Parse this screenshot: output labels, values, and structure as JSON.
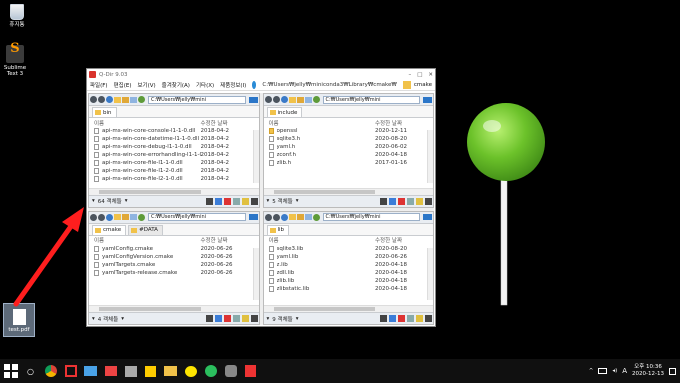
{
  "desktop": {
    "icons": [
      {
        "label": "휴지통"
      },
      {
        "label": "Sublime Text 3"
      },
      {
        "label": "test.pdf"
      }
    ]
  },
  "window": {
    "title": "Q-Dir 9.03",
    "menu": [
      "파일(F)",
      "편집(E)",
      "보기(V)",
      "즐겨찾기(A)",
      "기타(X)",
      "제품정보(I)"
    ],
    "menu_right": "cmake",
    "menu_address": "C:₩Users₩jelly₩miniconda3₩Library₩cmake₩",
    "panes": [
      {
        "address": "C:₩Users₩jelly₩mini",
        "tabs": [
          "bin"
        ],
        "header_name": "이름",
        "header_date": "수정한 날짜",
        "rows": [
          {
            "name": "api-ms-win-core-console-l1-1-0.dll",
            "date": "2018-04-2"
          },
          {
            "name": "api-ms-win-core-datetime-l1-1-0.dll",
            "date": "2018-04-2"
          },
          {
            "name": "api-ms-win-core-debug-l1-1-0.dll",
            "date": "2018-04-2"
          },
          {
            "name": "api-ms-win-core-errorhandling-l1-1-0.dll",
            "date": "2018-04-2"
          },
          {
            "name": "api-ms-win-core-file-l1-1-0.dll",
            "date": "2018-04-2"
          },
          {
            "name": "api-ms-win-core-file-l1-2-0.dll",
            "date": "2018-04-2"
          },
          {
            "name": "api-ms-win-core-file-l2-1-0.dll",
            "date": "2018-04-2"
          }
        ],
        "status": "64 객체들"
      },
      {
        "address": "C:₩Users₩jelly₩mini",
        "tabs": [
          "include"
        ],
        "header_name": "이름",
        "header_date": "수정한 날짜",
        "rows": [
          {
            "name": "openssl",
            "date": "2020-12-11",
            "dir": true
          },
          {
            "name": "sqlite3.h",
            "date": "2020-08-20"
          },
          {
            "name": "yaml.h",
            "date": "2020-06-02"
          },
          {
            "name": "zconf.h",
            "date": "2020-04-18"
          },
          {
            "name": "zlib.h",
            "date": "2017-01-16"
          }
        ],
        "status": "5 객체들"
      },
      {
        "address": "C:₩Users₩jelly₩mini",
        "tabs": [
          "cmake",
          "#DATA"
        ],
        "header_name": "이름",
        "header_date": "수정한 날짜",
        "rows": [
          {
            "name": "yamlConfig.cmake",
            "date": "2020-06-26"
          },
          {
            "name": "yamlConfigVersion.cmake",
            "date": "2020-06-26"
          },
          {
            "name": "yamlTargets.cmake",
            "date": "2020-06-26"
          },
          {
            "name": "yamlTargets-release.cmake",
            "date": "2020-06-26"
          }
        ],
        "status": "4 객체들"
      },
      {
        "address": "C:₩Users₩jelly₩mini",
        "tabs": [
          "lib"
        ],
        "header_name": "이름",
        "header_date": "수정한 날짜",
        "rows": [
          {
            "name": "sqlite3.lib",
            "date": "2020-08-20"
          },
          {
            "name": "yaml.lib",
            "date": "2020-06-26"
          },
          {
            "name": "z.lib",
            "date": "2020-04-18"
          },
          {
            "name": "zdll.lib",
            "date": "2020-04-18"
          },
          {
            "name": "zlib.lib",
            "date": "2020-04-18"
          },
          {
            "name": "zlibstatic.lib",
            "date": "2020-04-18"
          }
        ],
        "status": "9 객체들"
      }
    ]
  },
  "taskbar": {
    "ime": "A",
    "time_period": "오후 10:36",
    "date": "2020-12-13"
  },
  "colors": {
    "arrow": "#ff1e1e",
    "lollipop": "#6cc22a",
    "taskbar": "#101010"
  }
}
